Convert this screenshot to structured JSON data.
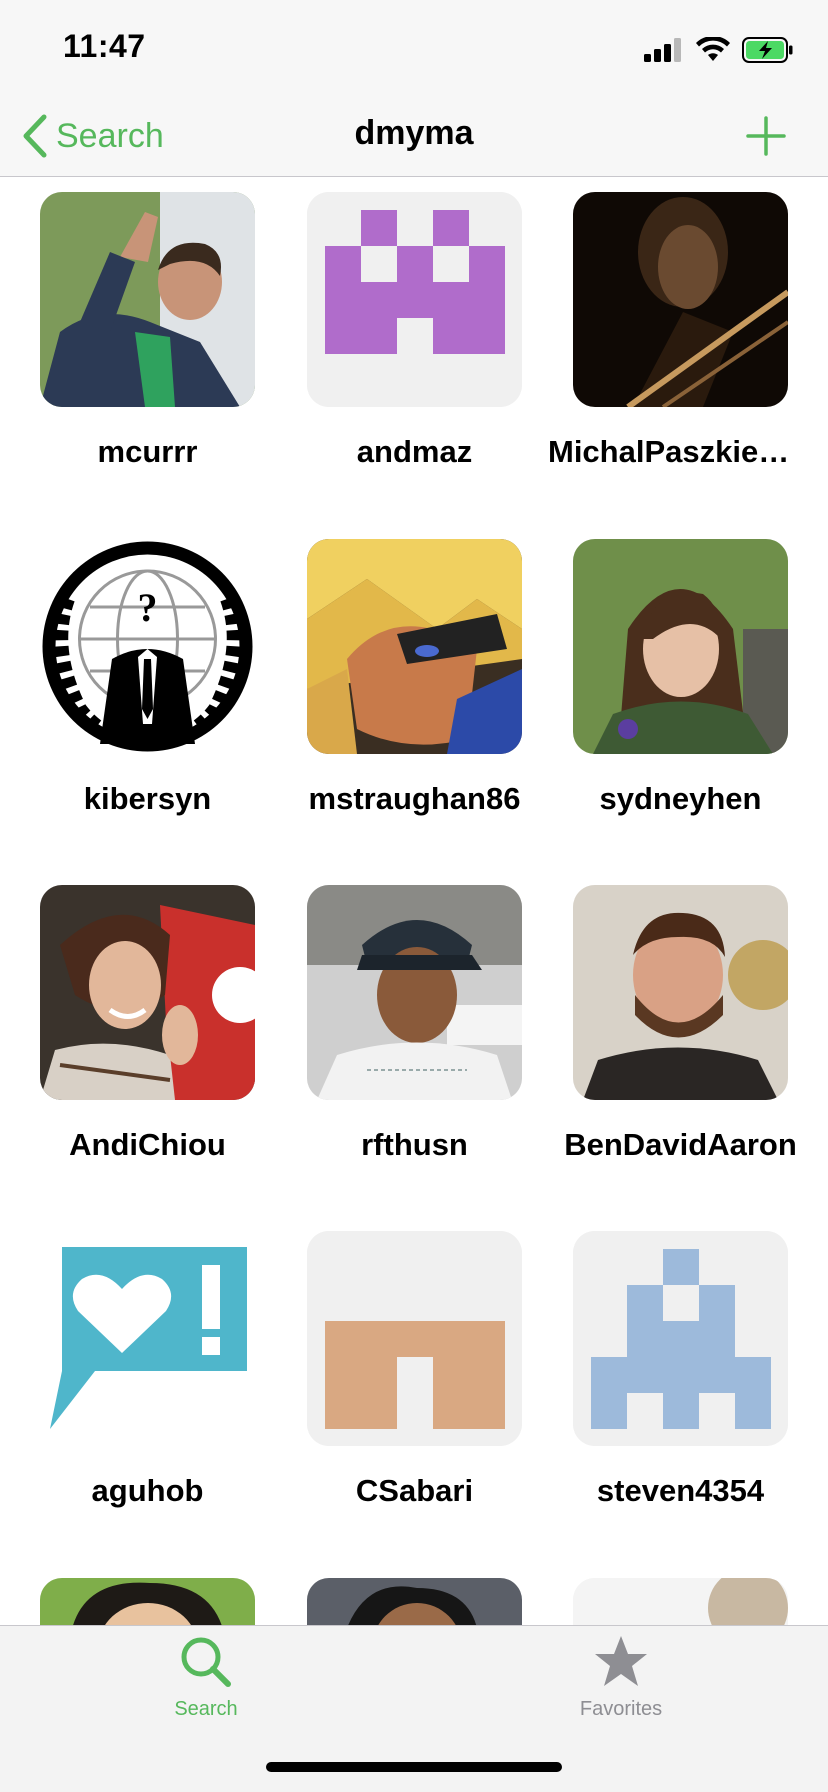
{
  "status_bar": {
    "time": "11:47",
    "battery_color": "#4cd964"
  },
  "nav": {
    "back_label": "Search",
    "title": "dmyma",
    "accent": "#56b85c"
  },
  "grid": {
    "users": [
      {
        "username": "mcurrr"
      },
      {
        "username": "andmaz"
      },
      {
        "username": "MichalPaszkiewicz"
      },
      {
        "username": "kibersyn"
      },
      {
        "username": "mstraughan86"
      },
      {
        "username": "sydneyhen"
      },
      {
        "username": "AndiChiou"
      },
      {
        "username": "rfthusn"
      },
      {
        "username": "BenDavidAaron"
      },
      {
        "username": "aguhob"
      },
      {
        "username": "CSabari"
      },
      {
        "username": "steven4354"
      }
    ]
  },
  "tabs": [
    {
      "label": "Search",
      "icon": "search-icon",
      "active": true
    },
    {
      "label": "Favorites",
      "icon": "star-icon",
      "active": false
    }
  ]
}
